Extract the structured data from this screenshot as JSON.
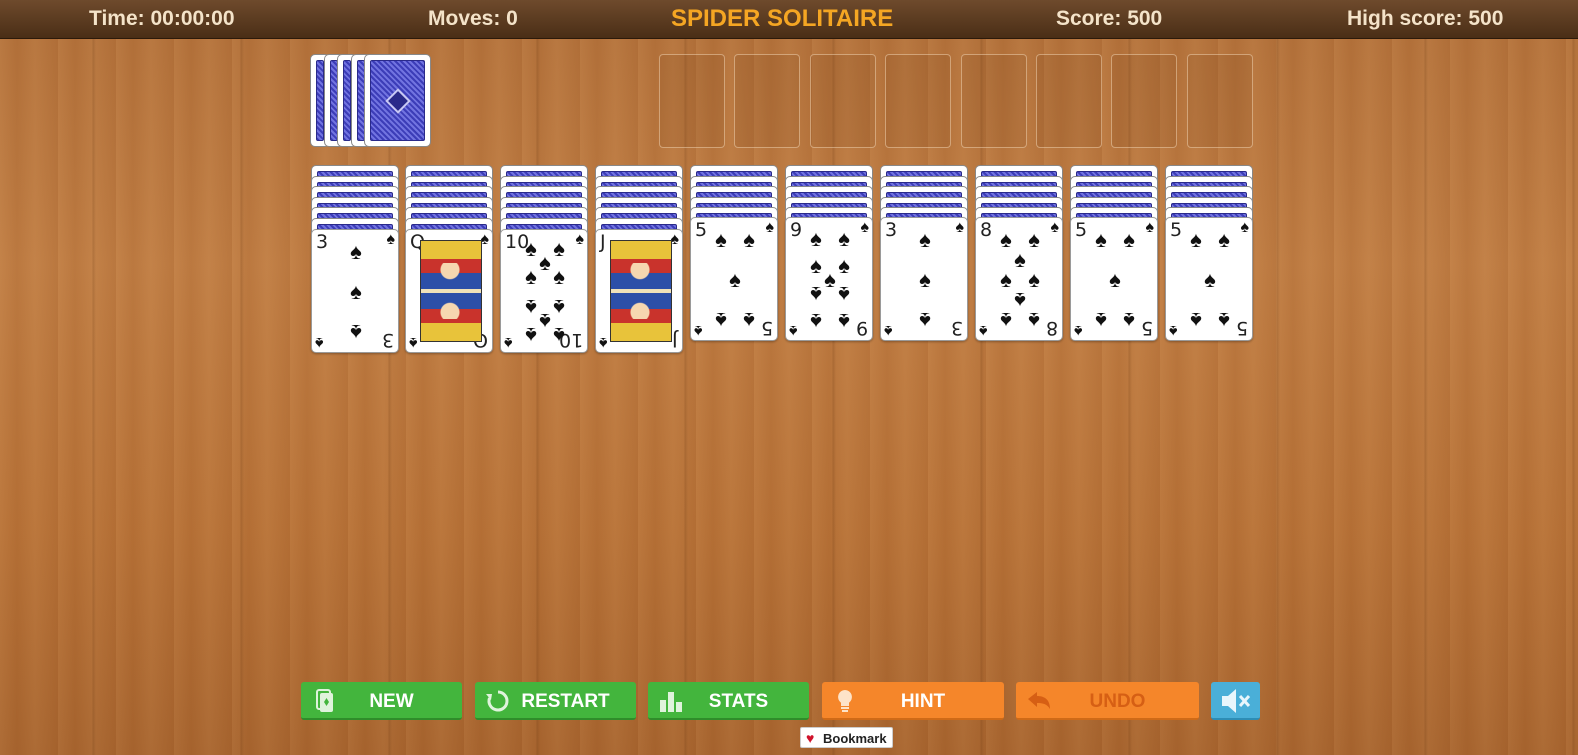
{
  "header": {
    "time": "Time: 00:00:00",
    "moves": "Moves: 0",
    "title": "SPIDER SOLITAIRE",
    "score": "Score: 500",
    "high_score": "High score: 500"
  },
  "stock": {
    "stacks_remaining": 5
  },
  "foundations": {
    "count": 8
  },
  "tableau": [
    {
      "face_down": 6,
      "top_card": {
        "rank": "3",
        "suit": "spades"
      }
    },
    {
      "face_down": 6,
      "top_card": {
        "rank": "Q",
        "suit": "spades"
      }
    },
    {
      "face_down": 6,
      "top_card": {
        "rank": "10",
        "suit": "spades"
      }
    },
    {
      "face_down": 6,
      "top_card": {
        "rank": "J",
        "suit": "spades"
      }
    },
    {
      "face_down": 5,
      "top_card": {
        "rank": "5",
        "suit": "spades"
      }
    },
    {
      "face_down": 5,
      "top_card": {
        "rank": "9",
        "suit": "spades"
      }
    },
    {
      "face_down": 5,
      "top_card": {
        "rank": "3",
        "suit": "spades"
      }
    },
    {
      "face_down": 5,
      "top_card": {
        "rank": "8",
        "suit": "spades"
      }
    },
    {
      "face_down": 5,
      "top_card": {
        "rank": "5",
        "suit": "spades"
      }
    },
    {
      "face_down": 5,
      "top_card": {
        "rank": "5",
        "suit": "spades"
      }
    }
  ],
  "buttons": {
    "new": {
      "label": "NEW",
      "icon": "new-deck-icon"
    },
    "restart": {
      "label": "RESTART",
      "icon": "restart-icon"
    },
    "stats": {
      "label": "STATS",
      "icon": "bar-chart-icon"
    },
    "hint": {
      "label": "HINT",
      "icon": "lightbulb-icon"
    },
    "undo": {
      "label": "UNDO",
      "icon": "undo-arrow-icon"
    },
    "mute": {
      "icon": "speaker-muted-icon"
    }
  },
  "bookmark": {
    "label": "Bookmark",
    "icon": "heart-icon"
  },
  "colors": {
    "title": "#f5a623",
    "button_green": "#43b53d",
    "button_orange": "#f5862a",
    "button_blue": "#4aafd8",
    "card_back": "#4a4bc6"
  }
}
